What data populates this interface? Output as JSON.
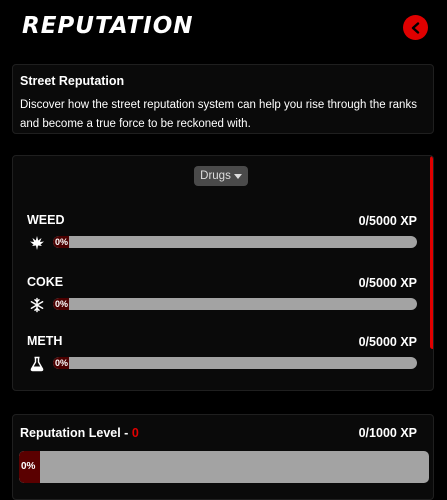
{
  "header": {
    "title": "Reputation",
    "back_icon": "chevron-left-icon",
    "accent_color": "#e00000"
  },
  "info": {
    "title": "Street Reputation",
    "description": "Discover how the street reputation system can help you rise through the ranks and become a true force to be reckoned with."
  },
  "category_select": {
    "selected": "Drugs"
  },
  "drugs": [
    {
      "name": "WEED",
      "xp": "0/5000 XP",
      "percent_label": "0%",
      "progress": 0,
      "icon": "cannabis-leaf-icon"
    },
    {
      "name": "COKE",
      "xp": "0/5000 XP",
      "percent_label": "0%",
      "progress": 0,
      "icon": "snowflake-icon"
    },
    {
      "name": "METH",
      "xp": "0/5000 XP",
      "percent_label": "0%",
      "progress": 0,
      "icon": "flask-icon"
    }
  ],
  "reputation_level": {
    "label": "Reputation Level - ",
    "level": "0",
    "xp": "0/1000 XP",
    "percent_label": "0%",
    "progress": 0
  }
}
